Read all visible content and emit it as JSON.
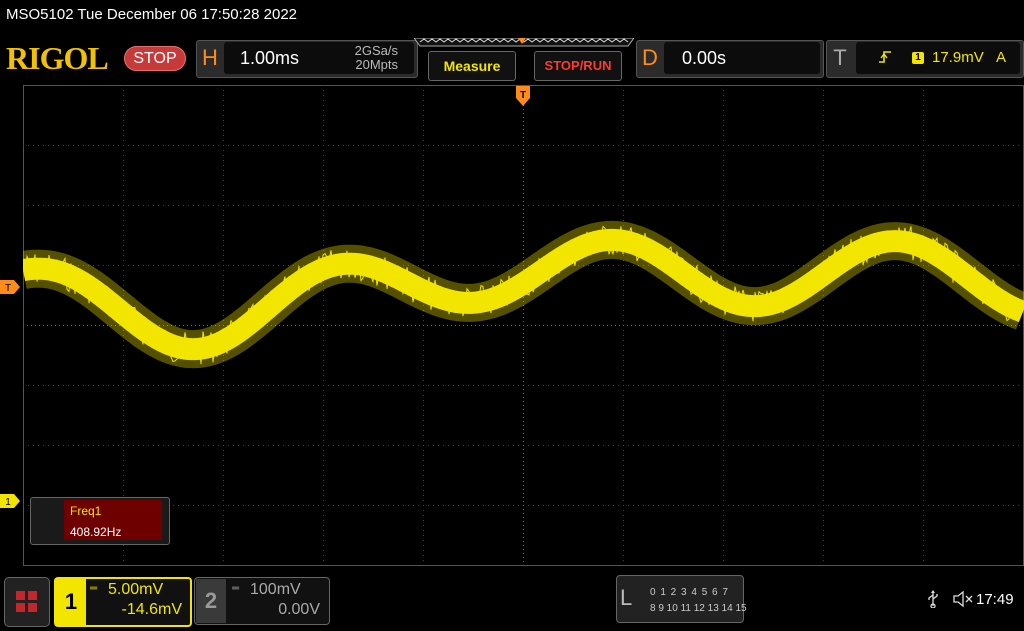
{
  "window": {
    "title": "MSO5102  Tue December 06 17:50:28 2022"
  },
  "brand": {
    "logo": "RIGOL",
    "status": "STOP"
  },
  "horizontal": {
    "label": "H",
    "timebase": "1.00ms",
    "sample_rate": "2GSa/s",
    "memory_depth": "20Mpts"
  },
  "buttons": {
    "measure": "Measure",
    "stop_run": "STOP/RUN"
  },
  "delay": {
    "label": "D",
    "value": "0.00s"
  },
  "trigger": {
    "label": "T",
    "source": "1",
    "level": "17.9mV",
    "mode": "A",
    "marker": "T",
    "slope_icon": "rising-edge-icon"
  },
  "screen_markers": {
    "trigger_level": "T",
    "channel1": "1"
  },
  "measurement": {
    "label": "Freq1",
    "value": "408.92Hz"
  },
  "channels": [
    {
      "number": "1",
      "scale": "5.00mV",
      "offset": "-14.6mV",
      "color": "#f2e600"
    },
    {
      "number": "2",
      "scale": "100mV",
      "offset": "0.00V",
      "color": "#9a9a9a"
    }
  ],
  "logic": {
    "label": "L",
    "row1": "0 1 2 3   4 5 6 7",
    "row2": "8  9 10 11  12 13 14 15"
  },
  "status_bar": {
    "usb_icon": "usb-icon",
    "speaker_icon": "speaker-muted-icon",
    "clock": "17:49"
  },
  "colors": {
    "trace": "#f2e600",
    "accent": "#ff8c1a",
    "stop": "#c73a3a",
    "grid": "#555555"
  }
}
